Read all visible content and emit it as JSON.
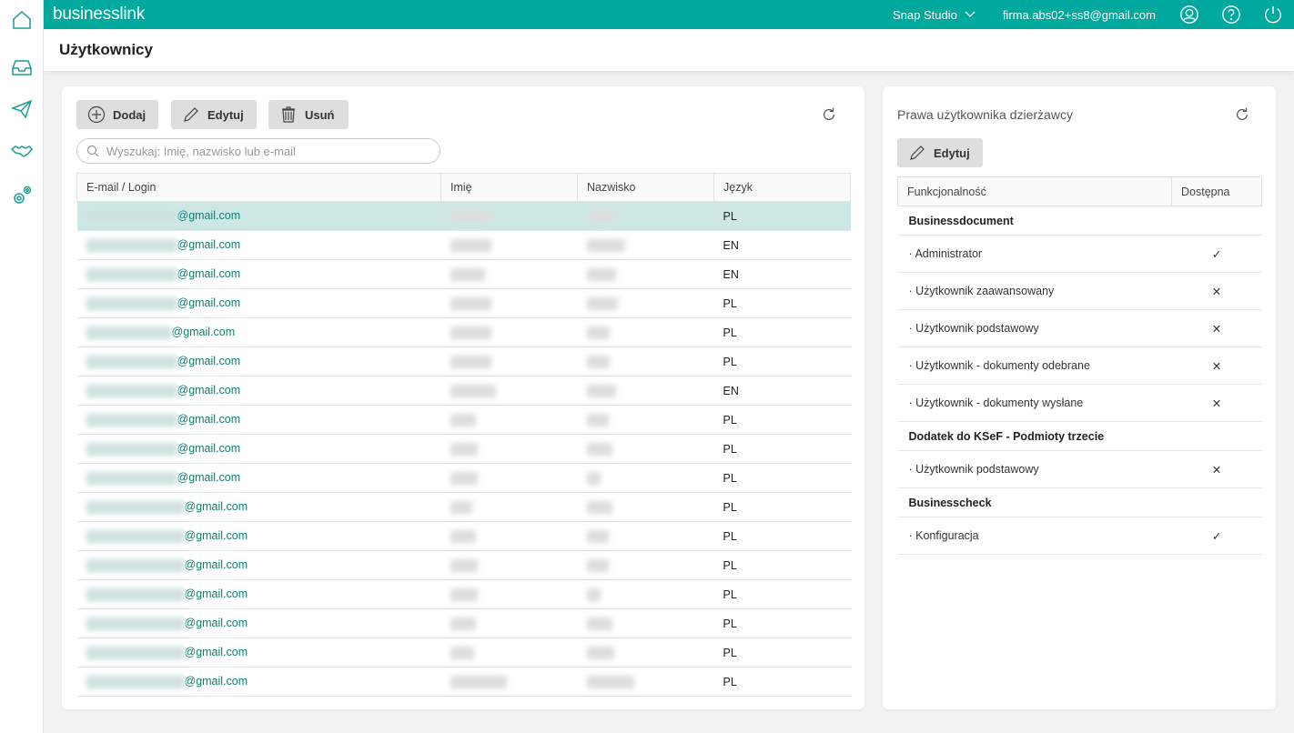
{
  "app": {
    "logo": "businesslink",
    "studio": "Snap Studio",
    "user_email": "firma.abs02+ss8@gmail.com"
  },
  "page": {
    "title": "Użytkownicy"
  },
  "sidebar": {
    "items": [
      "home-icon",
      "inbox-icon",
      "send-icon",
      "handshake-icon",
      "settings-icon"
    ]
  },
  "users": {
    "toolbar": {
      "add": "Dodaj",
      "edit": "Edytuj",
      "delete": "Usuń"
    },
    "search_placeholder": "Wyszukaj: Imię, nazwisko lub e-mail",
    "columns": [
      "E-mail / Login",
      "Imię",
      "Nazwisko",
      "Język"
    ],
    "rows": [
      {
        "email": "@gmail.com",
        "lang": "PL"
      },
      {
        "email": "@gmail.com",
        "lang": "EN"
      },
      {
        "email": "@gmail.com",
        "lang": "EN"
      },
      {
        "email": "@gmail.com",
        "lang": "PL"
      },
      {
        "email": "@gmail.com",
        "lang": "PL"
      },
      {
        "email": "@gmail.com",
        "lang": "PL"
      },
      {
        "email": "@gmail.com",
        "lang": "EN"
      },
      {
        "email": "@gmail.com",
        "lang": "PL"
      },
      {
        "email": "@gmail.com",
        "lang": "PL"
      },
      {
        "email": "@gmail.com",
        "lang": "PL"
      },
      {
        "email": "@gmail.com",
        "lang": "PL"
      },
      {
        "email": "@gmail.com",
        "lang": "PL"
      },
      {
        "email": "@gmail.com",
        "lang": "PL"
      },
      {
        "email": "@gmail.com",
        "lang": "PL"
      },
      {
        "email": "@gmail.com",
        "lang": "PL"
      },
      {
        "email": "@gmail.com",
        "lang": "PL"
      },
      {
        "email": "@gmail.com",
        "lang": "PL"
      }
    ]
  },
  "rights": {
    "title": "Prawa użytkownika dzierżawcy",
    "edit": "Edytuj",
    "columns": [
      "Funkcjonalność",
      "Dostępna"
    ],
    "rows": [
      {
        "type": "group",
        "label": "Businessdocument"
      },
      {
        "type": "item",
        "label": "· Administrator",
        "available": true
      },
      {
        "type": "item",
        "label": "· Użytkownik zaawansowany",
        "available": false
      },
      {
        "type": "item",
        "label": "· Użytkownik podstawowy",
        "available": false
      },
      {
        "type": "item",
        "label": "· Użytkownik - dokumenty odebrane",
        "available": false
      },
      {
        "type": "item",
        "label": "· Użytkownik - dokumenty wysłane",
        "available": false
      },
      {
        "type": "group",
        "label": "Dodatek do KSeF - Podmioty trzecie"
      },
      {
        "type": "item",
        "label": "· Użytkownik podstawowy",
        "available": false
      },
      {
        "type": "group",
        "label": "Businesscheck"
      },
      {
        "type": "item",
        "label": "· Konfiguracja",
        "available": true
      }
    ],
    "marks": {
      "yes": "✓",
      "no": "✕"
    }
  },
  "colors": {
    "brand": "#00a99d",
    "selected_row": "#cde8e4"
  }
}
